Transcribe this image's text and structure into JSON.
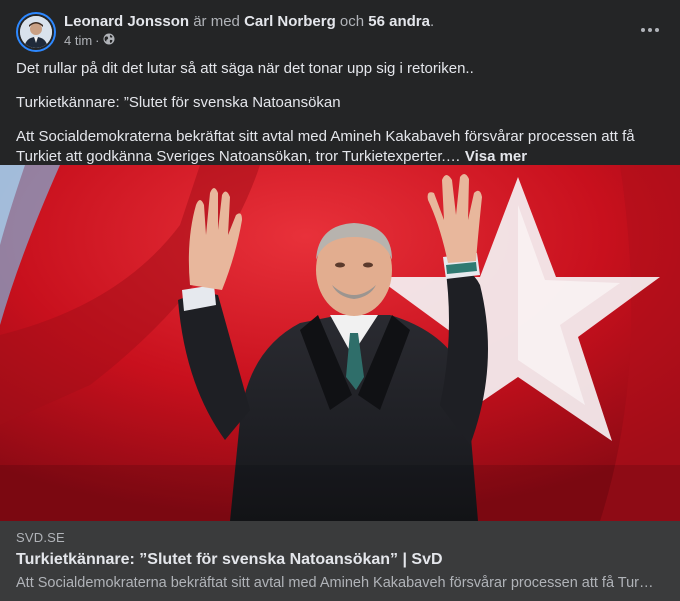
{
  "post": {
    "author": "Leonard Jonsson",
    "with_text": "är med",
    "tagged": "Carl Norberg",
    "and_text": "och",
    "others": "56 andra",
    "period": ".",
    "time": "4 tim",
    "separator": "·",
    "audience_icon": "globe-icon",
    "menu_icon": "more-options-icon",
    "paragraphs": [
      "Det rullar på dit det lutar så att säga när det tonar upp sig i retoriken..",
      "Turkietkännare: ”Slutet för svenska Natoansökan",
      "Att Socialdemokraterna bekräftat sitt avtal med Amineh Kakabaveh försvårar processen att få Turkiet att godkänna Sveriges Natoansökan, tror Turkietexperter.…"
    ],
    "see_more": "Visa mer"
  },
  "link_preview": {
    "domain": "SVD.SE",
    "title": "Turkietkännare: ”Slutet för svenska Natoansökan” | SvD",
    "description": "Att Socialdemokraterna bekräftat sitt avtal med Amineh Kakabaveh försvårar processen att få Turkiet att godkänna Sveriges Natoansökan, tror Turkietexperter."
  },
  "colors": {
    "background": "#242526",
    "text": "#e4e6eb",
    "muted": "#b0b3b8",
    "link_box": "#3a3b3c",
    "flag_red": "#d0141f",
    "avatar_ring": "#2d88ff"
  }
}
